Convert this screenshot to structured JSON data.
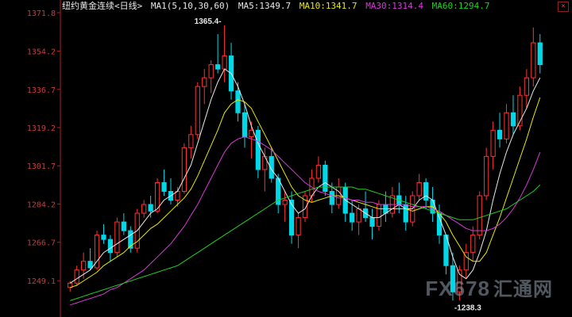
{
  "header": {
    "title": "纽约黄金连续",
    "period": "<日线>",
    "ma_params": "MA1(5,10,30,60)",
    "ma5": "MA5:1349.7",
    "ma10": "MA10:1341.7",
    "ma30": "MA30:1314.4",
    "ma60": "MA60:1294.7",
    "close_label": "×"
  },
  "colors": {
    "up": "#ff3232",
    "down": "#00d8e8",
    "ma5": "#e8e8e8",
    "ma10": "#e8e800",
    "ma30": "#d838d8",
    "ma60": "#20d020",
    "axis": "#b02020",
    "tick_text": "#c83c3c",
    "title": "#e8e8e8"
  },
  "watermark": {
    "text": "FX678",
    "text_cn": "汇通网"
  },
  "chart_data": {
    "type": "candlestick",
    "title": "纽约黄金连续<日线>",
    "ylim": [
      1238.3,
      1371.8
    ],
    "yticks": [
      "1371.8",
      "1354.2",
      "1336.7",
      "1319.2",
      "1301.7",
      "1284.2",
      "1266.7",
      "1249.1"
    ],
    "ytick_values": [
      1371.8,
      1354.2,
      1336.7,
      1319.2,
      1301.7,
      1284.2,
      1266.7,
      1249.1
    ],
    "annotations": {
      "high": "1365.4",
      "low": "1238.3"
    },
    "ohlc": [
      [
        1246,
        1249,
        1244,
        1248
      ],
      [
        1248,
        1256,
        1247,
        1254
      ],
      [
        1254,
        1262,
        1250,
        1258
      ],
      [
        1258,
        1264,
        1254,
        1255
      ],
      [
        1255,
        1272,
        1254,
        1270
      ],
      [
        1270,
        1275,
        1266,
        1268
      ],
      [
        1268,
        1270,
        1258,
        1262
      ],
      [
        1262,
        1278,
        1260,
        1276
      ],
      [
        1276,
        1280,
        1270,
        1272
      ],
      [
        1272,
        1274,
        1262,
        1264
      ],
      [
        1264,
        1282,
        1262,
        1280
      ],
      [
        1280,
        1286,
        1278,
        1284
      ],
      [
        1284,
        1288,
        1278,
        1281
      ],
      [
        1281,
        1296,
        1280,
        1294
      ],
      [
        1294,
        1300,
        1288,
        1290
      ],
      [
        1290,
        1296,
        1284,
        1286
      ],
      [
        1286,
        1292,
        1283,
        1290
      ],
      [
        1290,
        1312,
        1289,
        1310
      ],
      [
        1310,
        1320,
        1305,
        1316
      ],
      [
        1316,
        1340,
        1314,
        1338
      ],
      [
        1338,
        1346,
        1330,
        1342
      ],
      [
        1342,
        1350,
        1335,
        1348
      ],
      [
        1348,
        1362,
        1344,
        1346
      ],
      [
        1346,
        1366,
        1340,
        1352
      ],
      [
        1352,
        1358,
        1332,
        1336
      ],
      [
        1336,
        1340,
        1322,
        1326
      ],
      [
        1326,
        1330,
        1310,
        1315
      ],
      [
        1315,
        1322,
        1305,
        1318
      ],
      [
        1318,
        1320,
        1296,
        1300
      ],
      [
        1300,
        1310,
        1290,
        1306
      ],
      [
        1306,
        1310,
        1294,
        1296
      ],
      [
        1296,
        1298,
        1280,
        1284
      ],
      [
        1284,
        1290,
        1276,
        1286
      ],
      [
        1286,
        1290,
        1266,
        1270
      ],
      [
        1270,
        1280,
        1264,
        1278
      ],
      [
        1278,
        1290,
        1276,
        1288
      ],
      [
        1288,
        1300,
        1285,
        1296
      ],
      [
        1296,
        1306,
        1294,
        1302
      ],
      [
        1302,
        1304,
        1288,
        1290
      ],
      [
        1290,
        1294,
        1280,
        1284
      ],
      [
        1284,
        1296,
        1282,
        1292
      ],
      [
        1292,
        1294,
        1276,
        1280
      ],
      [
        1280,
        1286,
        1272,
        1276
      ],
      [
        1276,
        1284,
        1270,
        1282
      ],
      [
        1282,
        1290,
        1276,
        1278
      ],
      [
        1278,
        1282,
        1268,
        1274
      ],
      [
        1274,
        1286,
        1272,
        1284
      ],
      [
        1284,
        1290,
        1276,
        1280
      ],
      [
        1280,
        1292,
        1278,
        1288
      ],
      [
        1288,
        1294,
        1280,
        1284
      ],
      [
        1284,
        1288,
        1272,
        1276
      ],
      [
        1276,
        1290,
        1274,
        1288
      ],
      [
        1288,
        1298,
        1286,
        1294
      ],
      [
        1294,
        1296,
        1282,
        1286
      ],
      [
        1286,
        1292,
        1276,
        1280
      ],
      [
        1280,
        1284,
        1266,
        1270
      ],
      [
        1270,
        1268,
        1252,
        1256
      ],
      [
        1256,
        1262,
        1240,
        1244
      ],
      [
        1244,
        1256,
        1240,
        1254
      ],
      [
        1254,
        1266,
        1250,
        1262
      ],
      [
        1262,
        1274,
        1258,
        1270
      ],
      [
        1270,
        1290,
        1268,
        1288
      ],
      [
        1288,
        1310,
        1286,
        1306
      ],
      [
        1306,
        1322,
        1300,
        1318
      ],
      [
        1318,
        1326,
        1310,
        1314
      ],
      [
        1314,
        1330,
        1312,
        1326
      ],
      [
        1326,
        1334,
        1316,
        1320
      ],
      [
        1320,
        1338,
        1318,
        1334
      ],
      [
        1334,
        1346,
        1328,
        1342
      ],
      [
        1342,
        1365,
        1338,
        1358
      ],
      [
        1358,
        1362,
        1344,
        1348
      ]
    ],
    "series": [
      {
        "name": "MA5",
        "values": [
          1248,
          1250,
          1252,
          1254,
          1258,
          1262,
          1264,
          1266,
          1268,
          1270,
          1272,
          1276,
          1280,
          1282,
          1286,
          1288,
          1290,
          1296,
          1302,
          1312,
          1322,
          1332,
          1340,
          1346,
          1344,
          1338,
          1330,
          1320,
          1312,
          1306,
          1300,
          1296,
          1290,
          1284,
          1280,
          1282,
          1288,
          1292,
          1294,
          1292,
          1290,
          1286,
          1284,
          1282,
          1280,
          1278,
          1278,
          1280,
          1282,
          1284,
          1282,
          1282,
          1286,
          1288,
          1286,
          1278,
          1270,
          1260,
          1252,
          1250,
          1254,
          1262,
          1272,
          1286,
          1298,
          1308,
          1316,
          1322,
          1328,
          1336,
          1342
        ]
      },
      {
        "name": "MA10",
        "values": [
          1246,
          1247,
          1249,
          1251,
          1253,
          1256,
          1258,
          1260,
          1262,
          1265,
          1267,
          1270,
          1273,
          1275,
          1278,
          1281,
          1284,
          1287,
          1291,
          1297,
          1304,
          1311,
          1318,
          1326,
          1330,
          1332,
          1331,
          1328,
          1322,
          1316,
          1310,
          1304,
          1298,
          1292,
          1288,
          1286,
          1285,
          1286,
          1287,
          1288,
          1288,
          1287,
          1286,
          1285,
          1284,
          1283,
          1282,
          1282,
          1282,
          1282,
          1282,
          1281,
          1282,
          1283,
          1283,
          1280,
          1276,
          1270,
          1265,
          1260,
          1258,
          1258,
          1262,
          1270,
          1278,
          1287,
          1296,
          1305,
          1314,
          1324,
          1333
        ]
      },
      {
        "name": "MA30",
        "values": [
          1238,
          1239,
          1240,
          1241,
          1242,
          1243,
          1245,
          1246,
          1248,
          1250,
          1252,
          1254,
          1257,
          1260,
          1263,
          1266,
          1270,
          1274,
          1279,
          1284,
          1290,
          1296,
          1302,
          1308,
          1312,
          1314,
          1315,
          1314,
          1313,
          1311,
          1309,
          1306,
          1303,
          1300,
          1297,
          1294,
          1292,
          1290,
          1289,
          1288,
          1287,
          1287,
          1286,
          1286,
          1285,
          1285,
          1284,
          1284,
          1284,
          1284,
          1284,
          1283,
          1283,
          1283,
          1282,
          1281,
          1279,
          1277,
          1275,
          1273,
          1272,
          1272,
          1272,
          1273,
          1275,
          1278,
          1282,
          1287,
          1293,
          1300,
          1308
        ]
      },
      {
        "name": "MA60",
        "values": [
          1240,
          1241,
          1242,
          1243,
          1244,
          1245,
          1246,
          1247,
          1248,
          1249,
          1250,
          1251,
          1252,
          1253,
          1254,
          1255,
          1256,
          1258,
          1260,
          1262,
          1264,
          1266,
          1268,
          1270,
          1272,
          1274,
          1276,
          1278,
          1280,
          1282,
          1284,
          1286,
          1287,
          1288,
          1289,
          1290,
          1291,
          1292,
          1292,
          1292,
          1292,
          1292,
          1292,
          1291,
          1291,
          1290,
          1289,
          1288,
          1287,
          1286,
          1285,
          1284,
          1283,
          1282,
          1281,
          1280,
          1279,
          1278,
          1277,
          1277,
          1277,
          1278,
          1279,
          1280,
          1281,
          1282,
          1284,
          1286,
          1288,
          1290,
          1293
        ]
      }
    ]
  }
}
